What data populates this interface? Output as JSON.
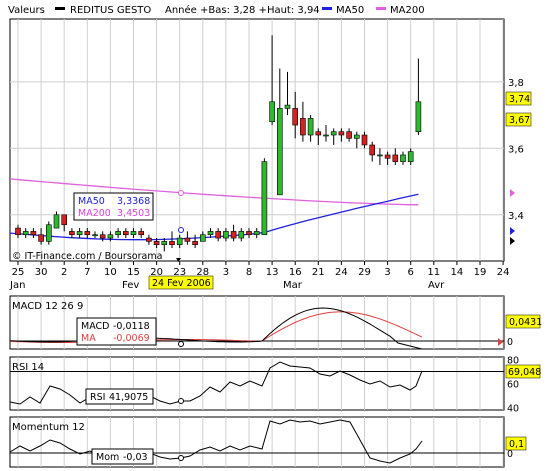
{
  "header": {
    "title_label": "Valeurs",
    "instrument": "REDITUS GESTO",
    "range_text": "Année +Bas: 3,28 +Haut: 3,94",
    "ma50_label": "MA50",
    "ma200_label": "MA200"
  },
  "colors": {
    "up": "#2db82d",
    "down": "#d42020",
    "ma50": "#2020e0",
    "ma200": "#e060e0",
    "macd_signal": "#e04040",
    "tag_bg": "#ffff00",
    "grid": "#cfcfcf"
  },
  "watermark": "© IT-Finance.com / Boursorama",
  "cursor": {
    "date_label": "24 Fev 2006",
    "ma50_label": "MA50",
    "ma50_value": "3,3368",
    "ma200_label": "MA200",
    "ma200_value": "3,4503",
    "macd_label": "MACD",
    "macd_value": "-0,0118",
    "ma_label": "MA",
    "ma_value": "-0,0069",
    "rsi_label": "RSI",
    "rsi_value": "41,9075",
    "mom_label": "Mom",
    "mom_value": "-0,03"
  },
  "panels": {
    "macd_title": "MACD 12 26 9",
    "rsi_title": "RSI 14",
    "mom_title": "Momentum 12"
  },
  "last_values": {
    "price_high": "3,74",
    "price_last": "3,67",
    "macd": "0,0431",
    "rsi": "69,048",
    "mom": "0,1"
  },
  "chart_data": {
    "type": "candlestick",
    "x_tick_labels": [
      "25",
      "30",
      "2",
      "7",
      "10",
      "15",
      "20",
      "23",
      "28",
      "3",
      "8",
      "13",
      "16",
      "21",
      "24",
      "29",
      "3",
      "6",
      "11",
      "14",
      "19",
      "24"
    ],
    "month_labels": [
      "Jan",
      "Fev",
      "Mar",
      "Avr"
    ],
    "price_axis": {
      "ticks": [
        "3,4",
        "3,6",
        "3,8"
      ],
      "ylim": [
        3.27,
        3.98
      ]
    },
    "candles": [
      {
        "o": 3.36,
        "h": 3.37,
        "l": 3.33,
        "c": 3.34
      },
      {
        "o": 3.34,
        "h": 3.36,
        "l": 3.33,
        "c": 3.35
      },
      {
        "o": 3.35,
        "h": 3.36,
        "l": 3.33,
        "c": 3.34
      },
      {
        "o": 3.34,
        "h": 3.36,
        "l": 3.31,
        "c": 3.32
      },
      {
        "o": 3.32,
        "h": 3.38,
        "l": 3.31,
        "c": 3.37
      },
      {
        "o": 3.36,
        "h": 3.41,
        "l": 3.36,
        "c": 3.4
      },
      {
        "o": 3.4,
        "h": 3.4,
        "l": 3.35,
        "c": 3.37
      },
      {
        "o": 3.35,
        "h": 3.36,
        "l": 3.33,
        "c": 3.34
      },
      {
        "o": 3.34,
        "h": 3.36,
        "l": 3.33,
        "c": 3.35
      },
      {
        "o": 3.35,
        "h": 3.36,
        "l": 3.33,
        "c": 3.34
      },
      {
        "o": 3.34,
        "h": 3.35,
        "l": 3.33,
        "c": 3.34
      },
      {
        "o": 3.34,
        "h": 3.35,
        "l": 3.32,
        "c": 3.33
      },
      {
        "o": 3.33,
        "h": 3.35,
        "l": 3.32,
        "c": 3.34
      },
      {
        "o": 3.34,
        "h": 3.36,
        "l": 3.33,
        "c": 3.35
      },
      {
        "o": 3.35,
        "h": 3.36,
        "l": 3.33,
        "c": 3.34
      },
      {
        "o": 3.34,
        "h": 3.36,
        "l": 3.33,
        "c": 3.35
      },
      {
        "o": 3.35,
        "h": 3.36,
        "l": 3.33,
        "c": 3.34
      },
      {
        "o": 3.33,
        "h": 3.34,
        "l": 3.31,
        "c": 3.32
      },
      {
        "o": 3.32,
        "h": 3.33,
        "l": 3.3,
        "c": 3.31
      },
      {
        "o": 3.31,
        "h": 3.33,
        "l": 3.29,
        "c": 3.32
      },
      {
        "o": 3.32,
        "h": 3.35,
        "l": 3.3,
        "c": 3.31
      },
      {
        "o": 3.31,
        "h": 3.34,
        "l": 3.3,
        "c": 3.33
      },
      {
        "o": 3.33,
        "h": 3.35,
        "l": 3.31,
        "c": 3.32
      },
      {
        "o": 3.32,
        "h": 3.34,
        "l": 3.3,
        "c": 3.31
      },
      {
        "o": 3.32,
        "h": 3.35,
        "l": 3.32,
        "c": 3.34
      },
      {
        "o": 3.34,
        "h": 3.36,
        "l": 3.33,
        "c": 3.35
      },
      {
        "o": 3.35,
        "h": 3.36,
        "l": 3.32,
        "c": 3.33
      },
      {
        "o": 3.33,
        "h": 3.36,
        "l": 3.32,
        "c": 3.35
      },
      {
        "o": 3.35,
        "h": 3.37,
        "l": 3.32,
        "c": 3.33
      },
      {
        "o": 3.33,
        "h": 3.36,
        "l": 3.32,
        "c": 3.35
      },
      {
        "o": 3.35,
        "h": 3.36,
        "l": 3.33,
        "c": 3.34
      },
      {
        "o": 3.34,
        "h": 3.36,
        "l": 3.33,
        "c": 3.35
      },
      {
        "o": 3.34,
        "h": 3.57,
        "l": 3.34,
        "c": 3.56
      },
      {
        "o": 3.68,
        "h": 3.94,
        "l": 3.67,
        "c": 3.74
      },
      {
        "o": 3.46,
        "h": 3.84,
        "l": 3.46,
        "c": 3.72
      },
      {
        "o": 3.72,
        "h": 3.83,
        "l": 3.7,
        "c": 3.73
      },
      {
        "o": 3.72,
        "h": 3.77,
        "l": 3.63,
        "c": 3.67
      },
      {
        "o": 3.69,
        "h": 3.74,
        "l": 3.62,
        "c": 3.64
      },
      {
        "o": 3.64,
        "h": 3.7,
        "l": 3.62,
        "c": 3.69
      },
      {
        "o": 3.65,
        "h": 3.66,
        "l": 3.61,
        "c": 3.64
      },
      {
        "o": 3.64,
        "h": 3.67,
        "l": 3.62,
        "c": 3.64
      },
      {
        "o": 3.64,
        "h": 3.66,
        "l": 3.61,
        "c": 3.65
      },
      {
        "o": 3.65,
        "h": 3.66,
        "l": 3.62,
        "c": 3.64
      },
      {
        "o": 3.65,
        "h": 3.66,
        "l": 3.62,
        "c": 3.63
      },
      {
        "o": 3.63,
        "h": 3.65,
        "l": 3.6,
        "c": 3.64
      },
      {
        "o": 3.64,
        "h": 3.65,
        "l": 3.6,
        "c": 3.61
      },
      {
        "o": 3.61,
        "h": 3.62,
        "l": 3.56,
        "c": 3.58
      },
      {
        "o": 3.58,
        "h": 3.6,
        "l": 3.55,
        "c": 3.58
      },
      {
        "o": 3.58,
        "h": 3.59,
        "l": 3.55,
        "c": 3.57
      },
      {
        "o": 3.58,
        "h": 3.6,
        "l": 3.55,
        "c": 3.56
      },
      {
        "o": 3.56,
        "h": 3.59,
        "l": 3.55,
        "c": 3.58
      },
      {
        "o": 3.56,
        "h": 3.6,
        "l": 3.55,
        "c": 3.59
      },
      {
        "o": 3.65,
        "h": 3.87,
        "l": 3.64,
        "c": 3.74
      }
    ],
    "ma50": {
      "start": 3.345,
      "end": 3.462
    },
    "ma200": {
      "start": 3.508,
      "end": 3.43
    },
    "macd_axis": {
      "ticks": [
        "0"
      ],
      "ylim": [
        -0.05,
        0.09
      ]
    },
    "rsi_axis": {
      "ticks": [
        "40",
        "60",
        "80"
      ],
      "ylim": [
        38,
        82
      ],
      "bands": [
        70,
        30
      ]
    },
    "mom_axis": {
      "ticks": [
        "0"
      ],
      "ylim": [
        -0.12,
        0.5
      ]
    }
  }
}
